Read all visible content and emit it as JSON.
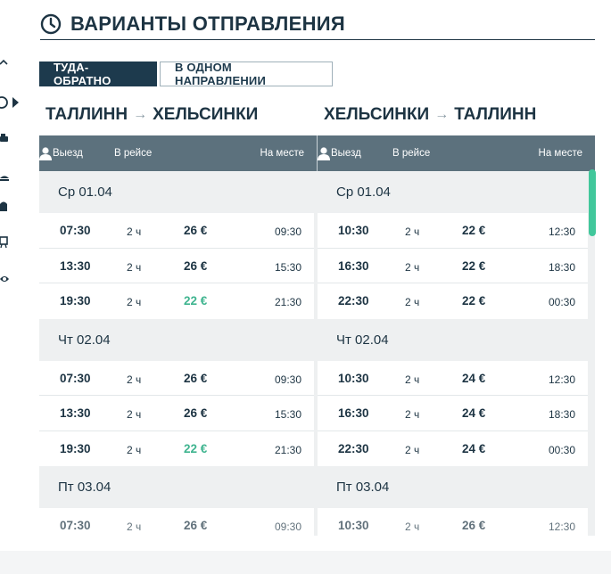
{
  "page": {
    "title": "ВАРИАНТЫ ОТПРАВЛЕНИЯ",
    "tabs": [
      {
        "label": "ТУДА-ОБРАТНО",
        "active": true
      },
      {
        "label": "В ОДНОМ НАПРАВЛЕНИИ",
        "active": false
      }
    ]
  },
  "table_header": {
    "departure": "Выезд",
    "duration": "В рейсе",
    "arrival": "На месте"
  },
  "outbound": {
    "from": "ТАЛЛИНН",
    "to": "ХЕЛЬСИНКИ",
    "days": [
      {
        "label": "Ср 01.04",
        "trips": [
          {
            "dep": "07:30",
            "dur": "2 ч",
            "price": "26 €",
            "arr": "09:30",
            "cheap": false
          },
          {
            "dep": "13:30",
            "dur": "2 ч",
            "price": "26 €",
            "arr": "15:30",
            "cheap": false
          },
          {
            "dep": "19:30",
            "dur": "2 ч",
            "price": "22 €",
            "arr": "21:30",
            "cheap": true
          }
        ]
      },
      {
        "label": "Чт 02.04",
        "trips": [
          {
            "dep": "07:30",
            "dur": "2 ч",
            "price": "26 €",
            "arr": "09:30",
            "cheap": false
          },
          {
            "dep": "13:30",
            "dur": "2 ч",
            "price": "26 €",
            "arr": "15:30",
            "cheap": false
          },
          {
            "dep": "19:30",
            "dur": "2 ч",
            "price": "22 €",
            "arr": "21:30",
            "cheap": true
          }
        ]
      },
      {
        "label": "Пт 03.04",
        "trips": [
          {
            "dep": "07:30",
            "dur": "2 ч",
            "price": "26 €",
            "arr": "09:30",
            "cheap": false
          }
        ]
      }
    ]
  },
  "inbound": {
    "from": "ХЕЛЬСИНКИ",
    "to": "ТАЛЛИНН",
    "days": [
      {
        "label": "Ср 01.04",
        "trips": [
          {
            "dep": "10:30",
            "dur": "2 ч",
            "price": "22 €",
            "arr": "12:30",
            "cheap": false
          },
          {
            "dep": "16:30",
            "dur": "2 ч",
            "price": "22 €",
            "arr": "18:30",
            "cheap": false
          },
          {
            "dep": "22:30",
            "dur": "2 ч",
            "price": "22 €",
            "arr": "00:30",
            "cheap": false
          }
        ]
      },
      {
        "label": "Чт 02.04",
        "trips": [
          {
            "dep": "10:30",
            "dur": "2 ч",
            "price": "24 €",
            "arr": "12:30",
            "cheap": false
          },
          {
            "dep": "16:30",
            "dur": "2 ч",
            "price": "24 €",
            "arr": "18:30",
            "cheap": false
          },
          {
            "dep": "22:30",
            "dur": "2 ч",
            "price": "24 €",
            "arr": "00:30",
            "cheap": false
          }
        ]
      },
      {
        "label": "Пт 03.04",
        "trips": [
          {
            "dep": "10:30",
            "dur": "2 ч",
            "price": "26 €",
            "arr": "12:30",
            "cheap": false
          }
        ]
      }
    ]
  },
  "colors": {
    "navy": "#1d3a4d",
    "header_gray": "#5c717d",
    "cheap_green": "#3fb48f",
    "scroll_green": "#41c79b"
  },
  "icons": {
    "title": "clock-icon",
    "header_person": "person-icon"
  }
}
